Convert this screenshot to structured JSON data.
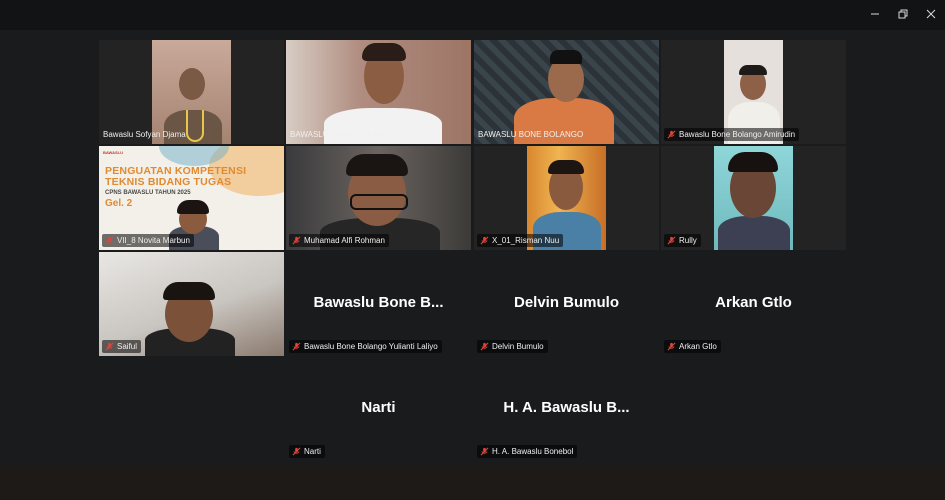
{
  "window": {
    "minimize_icon": "minimize-icon",
    "restore_icon": "restore-icon",
    "close_icon": "close-icon"
  },
  "colors": {
    "active_speaker": "#2fd37a",
    "muted_mic": "#e0453a",
    "name_text": "#ffffff"
  },
  "participants": [
    {
      "label": "Bawaslu Sofyan Djama",
      "muted": false,
      "video": true
    },
    {
      "label": "BAWASLU BONE BOLANGO",
      "muted": false,
      "video": true,
      "active": true
    },
    {
      "label": "BAWASLU BONE BOLANGO",
      "muted": false,
      "video": true
    },
    {
      "label": "Bawaslu Bone Bolango Amirudin",
      "muted": true,
      "video": true
    },
    {
      "label": "VII_8 Novita Marbun",
      "muted": true,
      "video": true,
      "sharing": true
    },
    {
      "label": "Muhamad Alfi Rohman",
      "muted": true,
      "video": true
    },
    {
      "label": "X_01_Risman Nuu",
      "muted": true,
      "video": true
    },
    {
      "label": "Rully",
      "muted": true,
      "video": true
    },
    {
      "label": "Saiful",
      "muted": true,
      "video": true
    },
    {
      "label": "Bawaslu Bone Bolango Yulianti Laliyo",
      "display_name": "Bawaslu Bone B...",
      "muted": true,
      "video": false
    },
    {
      "label": "Delvin Bumulo",
      "display_name": "Delvin Bumulo",
      "muted": true,
      "video": false
    },
    {
      "label": "Arkan Gtlo",
      "display_name": "Arkan Gtlo",
      "muted": true,
      "video": false
    },
    {
      "label": "Narti",
      "display_name": "Narti",
      "muted": true,
      "video": false
    },
    {
      "label": "H. A. Bawaslu Bonebol",
      "display_name": "H. A. Bawaslu B...",
      "muted": true,
      "video": false
    }
  ],
  "shared_slide": {
    "logo": "BAWASLU",
    "title_line1": "PENGUATAN KOMPETENSI",
    "title_line2": "TEKNIS BIDANG TUGAS",
    "subtitle": "CPNS BAWASLU TAHUN 2025",
    "gel": "Gel. 2"
  }
}
